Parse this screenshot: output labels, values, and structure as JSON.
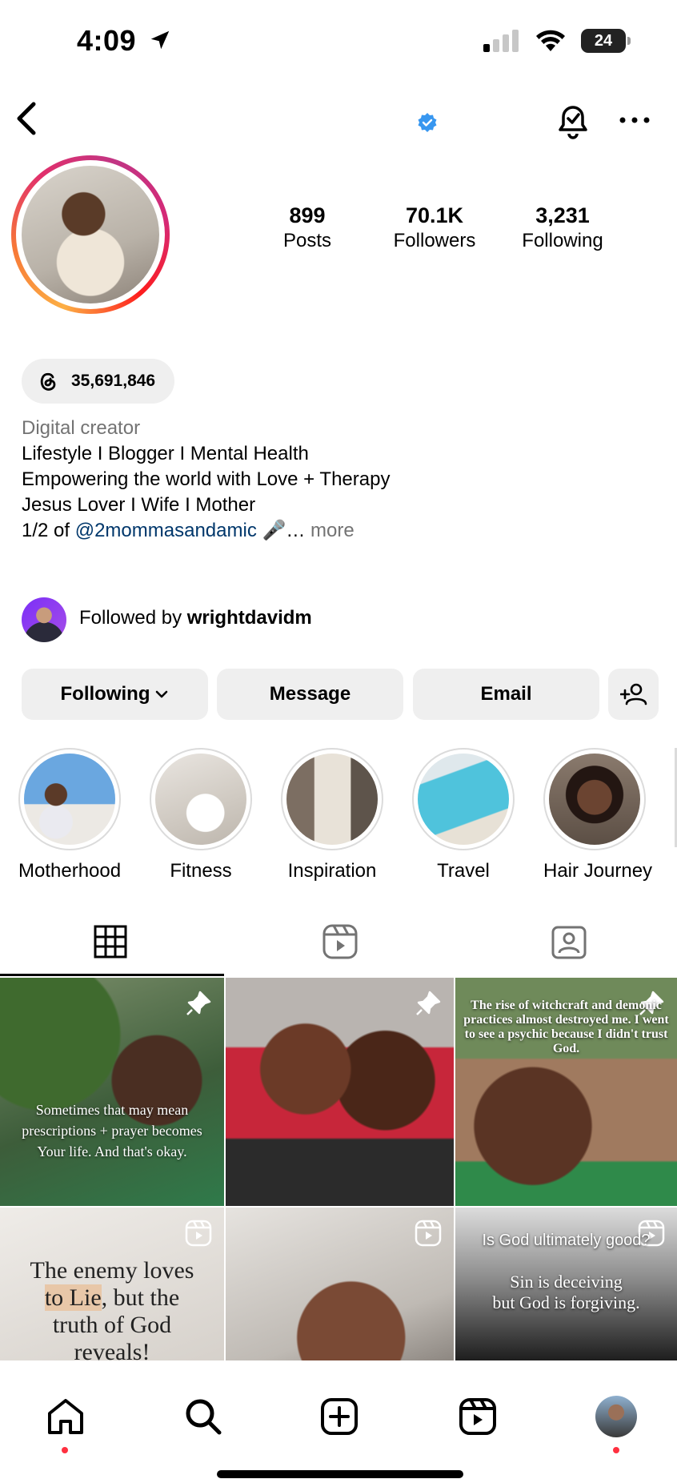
{
  "status_bar": {
    "time": "4:09",
    "battery": "24"
  },
  "profile": {
    "stats": [
      {
        "value": "899",
        "label": "Posts"
      },
      {
        "value": "70.1K",
        "label": "Followers"
      },
      {
        "value": "3,231",
        "label": "Following"
      }
    ],
    "threads_count": "35,691,846",
    "category": "Digital creator",
    "bio_lines": [
      "Lifestyle I Blogger I Mental Health",
      "Empowering the world with Love + Therapy",
      "Jesus Lover I Wife I Mother"
    ],
    "bio_last_prefix": "1/2 of ",
    "bio_mention": "@2mommasandamic",
    "bio_last_suffix": " 🎤… ",
    "bio_more": "more",
    "followed_by_prefix": "Followed by ",
    "followed_by_user": "wrightdavidm"
  },
  "actions": {
    "following": "Following",
    "message": "Message",
    "email": "Email"
  },
  "highlights": [
    {
      "label": "Motherhood"
    },
    {
      "label": "Fitness"
    },
    {
      "label": "Inspiration"
    },
    {
      "label": "Travel"
    },
    {
      "label": "Hair Journey"
    }
  ],
  "posts": {
    "p1_text": "Sometimes that may mean prescriptions + prayer becomes Your life. And that's okay.",
    "p3_text": "The rise of witchcraft and demonic practices almost destroyed me. I went to see a psychic because I didn't trust God.",
    "p4_line1": "The enemy loves",
    "p4_line2a": "to Lie",
    "p4_line2b": ", but the",
    "p4_line3": "truth of God",
    "p4_line4": "reveals!",
    "p6_title": "Is God ultimately good?",
    "p6_line1": "Sin is deceiving",
    "p6_line2": "but God is forgiving."
  },
  "colors": {
    "verified": "#3897f0",
    "link": "#00376b",
    "button_bg": "#efefef",
    "notification_dot": "#ff3040"
  },
  "icons": [
    "back-arrow-icon",
    "verified-badge-icon",
    "bell-icon",
    "more-icon",
    "threads-icon",
    "chevron-down-icon",
    "add-person-icon",
    "grid-icon",
    "reels-icon",
    "tagged-icon",
    "pin-icon",
    "reel-icon",
    "home-icon",
    "search-icon",
    "create-icon",
    "reels-nav-icon"
  ]
}
